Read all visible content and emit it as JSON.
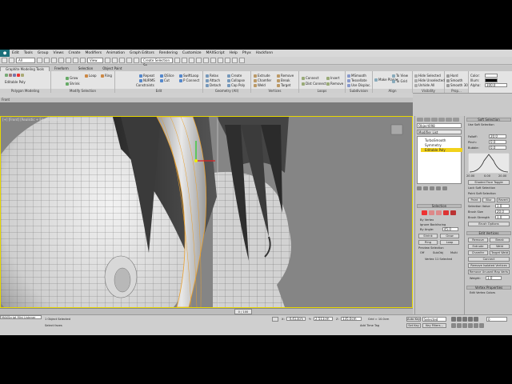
{
  "menu": [
    "Edit",
    "Tools",
    "Group",
    "Views",
    "Create",
    "Modifiers",
    "Animation",
    "Graph Editors",
    "Rendering",
    "Customize",
    "MAXScript",
    "Help",
    "Phyx",
    "Hackfonn"
  ],
  "toolbar": {
    "selection_filter": "All",
    "coord_system": "View",
    "named_sel": "Create Selection Se"
  },
  "ribbon_tabs": [
    "Graphite Modeling Tools",
    "Freeform",
    "Selection",
    "Object Paint"
  ],
  "ribbon_active_tab": "Graphite Modeling Tools",
  "ribbon": {
    "polygon_modeling": {
      "item": "Editable Poly",
      "label": "Polygon Modeling"
    },
    "modify_selection": {
      "items": [
        "Grow",
        "Shrink",
        "Loop",
        "Ring"
      ],
      "label": "Modify Selection"
    },
    "edit": {
      "items": [
        "Repeat",
        "NURMS",
        "Constraints",
        "QSlice",
        "Cut",
        "SwiftLoop",
        "P Connect"
      ],
      "label": "Edit"
    },
    "geometry": {
      "items": [
        "Relax",
        "Attach",
        "Detach",
        "Create",
        "Collapse",
        "Cap Poly"
      ],
      "label": "Geometry (All)"
    },
    "vertices": {
      "items": [
        "Extrude",
        "Chamfer",
        "Weld",
        "Remove",
        "Break",
        "Target"
      ],
      "label": "Vertices"
    },
    "loops": {
      "items": [
        "Connect",
        "Dist Connect",
        "Insert",
        "Remove"
      ],
      "label": "Loops"
    },
    "subdivision": {
      "items": [
        "MSmooth",
        "Tessellate",
        "Use Displac."
      ],
      "label": "Subdivision"
    },
    "align": {
      "items": [
        "Make Planar",
        "To View",
        "To Grid"
      ],
      "label": "Align"
    },
    "visibility": {
      "items": [
        "Hide Selected",
        "Hide Unselected",
        "Unhide All"
      ],
      "label": "Visibility"
    },
    "properties": {
      "items": [
        "Hard",
        "Smooth",
        "Smooth 30"
      ],
      "label": "Prop..."
    },
    "color": {
      "color_label": "Color:",
      "illum_label": "Illum:",
      "alpha_label": "Alpha:",
      "alpha_value": "100.0"
    }
  },
  "viewport": {
    "caption": "[+] [Front] [Realistic + Edged Faces]",
    "view_label": "Front",
    "accent": "#e8d800"
  },
  "modify_panel": {
    "object_name": "Object098",
    "modifier_list": "Modifier List",
    "stack": [
      "TurboSmooth",
      "Symmetry",
      "Editable Poly"
    ],
    "selection_title": "Selection",
    "selection_options": [
      "By Vertex",
      "Ignore Backfacing",
      "By Angle:"
    ],
    "angle_value": "45.0",
    "shrink": "Shrink",
    "grow": "Grow",
    "ring": "Ring",
    "loop": "Loop",
    "preview_title": "Preview Selection",
    "preview_options": [
      "Off",
      "SubObj",
      "Multi"
    ],
    "status": "Vertex 11 Selected"
  },
  "soft_selection": {
    "title": "Soft Selection",
    "use_soft": "Use Soft Selection",
    "fields": [
      {
        "label": "Falloff:",
        "value": "20.0"
      },
      {
        "label": "Pinch:",
        "value": "0.0"
      },
      {
        "label": "Bubble:",
        "value": "0.0"
      }
    ],
    "curve_ticks": [
      "20.00",
      "0.00",
      "20.00"
    ],
    "shaded_face_toggle": "Shaded Face Toggle",
    "lock_soft": "Lock Soft Selection",
    "paint_soft": "Paint Soft Selection",
    "paint": "Paint",
    "blur": "Blur",
    "revert": "Revert",
    "selection_value_label": "Selection Value",
    "selection_value": "1.0",
    "brush_size_label": "Brush Size",
    "brush_size": "20.0",
    "brush_strength_label": "Brush Strength",
    "brush_strength": "1.0",
    "brush_options": "Brush Options"
  },
  "edit_vertices": {
    "title": "Edit Vertices",
    "buttons": [
      "Remove",
      "Break",
      "Extrude",
      "Weld",
      "Chamfer",
      "Target Weld",
      "Connect",
      "Remove Isolated Vertices",
      "Remove Unused Map Verts"
    ],
    "weight_label": "Weight:",
    "weight_value": "1.0"
  },
  "vertex_props": {
    "title": "Vertex Properties",
    "edit_vertex_colors": "Edit Vertex Colors"
  },
  "timeline": {
    "position": "0 / 100"
  },
  "status": {
    "maxscript": "MAXScript Mini Listener",
    "line1": "1 Object Selected",
    "line2": "Select faces",
    "x_label": "X:",
    "x_value": "-4.413cm",
    "y_label": "Y:",
    "y_value": "2.511cm",
    "z_label": "Z:",
    "z_value": "135.0cm",
    "grid": "Grid = 10.0cm",
    "autokey_label": "Auto Key",
    "autokey_value": "Selected",
    "setkey_label": "Set Key",
    "key_filters": "Key Filters...",
    "add_time_tag": "Add Time Tag",
    "frame": "0"
  }
}
